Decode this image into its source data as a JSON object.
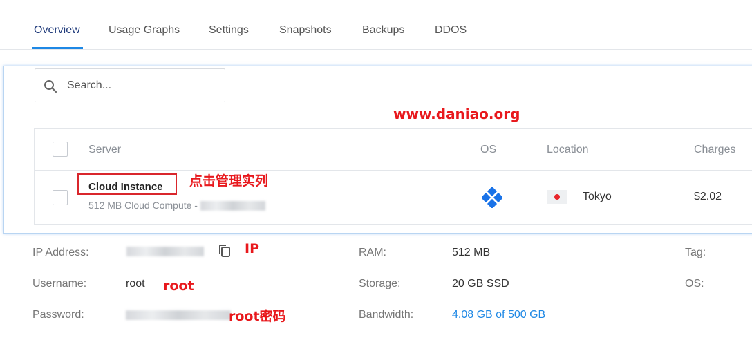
{
  "tabs": [
    {
      "label": "Overview",
      "active": true
    },
    {
      "label": "Usage Graphs"
    },
    {
      "label": "Settings"
    },
    {
      "label": "Snapshots"
    },
    {
      "label": "Backups"
    },
    {
      "label": "DDOS"
    }
  ],
  "search": {
    "placeholder": "Search..."
  },
  "watermark": "www.daniao.org",
  "table": {
    "headers": {
      "server": "Server",
      "os": "OS",
      "location": "Location",
      "charges": "Charges"
    },
    "rows": [
      {
        "name": "Cloud Instance",
        "subtitle": "512 MB Cloud Compute - ",
        "location": "Tokyo",
        "charges": "$2.02",
        "os_icon": "os-logo-icon",
        "flag": "japan-flag-icon"
      }
    ]
  },
  "annotations": {
    "manage": "点击管理实列",
    "ip": "IP",
    "root": "root",
    "password": "root密码"
  },
  "details": {
    "ip_label": "IP Address:",
    "username_label": "Username:",
    "username_value": "root",
    "password_label": "Password:",
    "ram_label": "RAM:",
    "ram_value": "512 MB",
    "storage_label": "Storage:",
    "storage_value": "20 GB SSD",
    "bandwidth_label": "Bandwidth:",
    "bandwidth_value": "4.08 GB of 500 GB",
    "tag_label": "Tag:",
    "os_label": "OS:"
  },
  "colors": {
    "accent": "#1e88e5",
    "annotation": "#e8181c",
    "flag_red": "#e8262c"
  }
}
